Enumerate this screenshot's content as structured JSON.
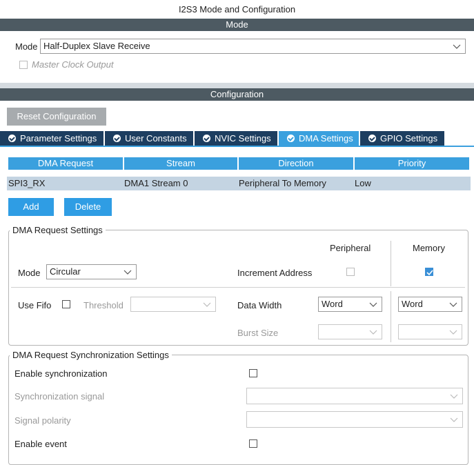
{
  "window_title": "I2S3 Mode and Configuration",
  "mode_bar": "Mode",
  "mode": {
    "label": "Mode",
    "value": "Half-Duplex Slave Receive",
    "master_clock_label": "Master Clock Output"
  },
  "config_bar": "Configuration",
  "reset_button": "Reset Configuration",
  "tabs": [
    {
      "label": "Parameter Settings"
    },
    {
      "label": "User Constants"
    },
    {
      "label": "NVIC Settings"
    },
    {
      "label": "DMA Settings",
      "active": true
    },
    {
      "label": "GPIO Settings"
    }
  ],
  "dma_table": {
    "headers": [
      "DMA Request",
      "Stream",
      "Direction",
      "Priority"
    ],
    "rows": [
      [
        "SPI3_RX",
        "DMA1 Stream 0",
        "Peripheral To Memory",
        "Low"
      ]
    ]
  },
  "buttons": {
    "add": "Add",
    "delete": "Delete"
  },
  "request_settings": {
    "legend": "DMA Request Settings",
    "peripheral_header": "Peripheral",
    "memory_header": "Memory",
    "mode_label": "Mode",
    "mode_value": "Circular",
    "increment_label": "Increment Address",
    "use_fifo_label": "Use Fifo",
    "threshold_label": "Threshold",
    "data_width_label": "Data Width",
    "peripheral_width": "Word",
    "memory_width": "Word",
    "burst_label": "Burst Size"
  },
  "sync_settings": {
    "legend": "DMA Request Synchronization Settings",
    "enable_sync_label": "Enable synchronization",
    "sync_signal_label": "Synchronization signal",
    "polarity_label": "Signal polarity",
    "enable_event_label": "Enable event"
  },
  "colors": {
    "header_bar": "#4d5a62",
    "tab_dark": "#1d3e60",
    "accent": "#3aa0de",
    "row": "#c4d4e2"
  }
}
